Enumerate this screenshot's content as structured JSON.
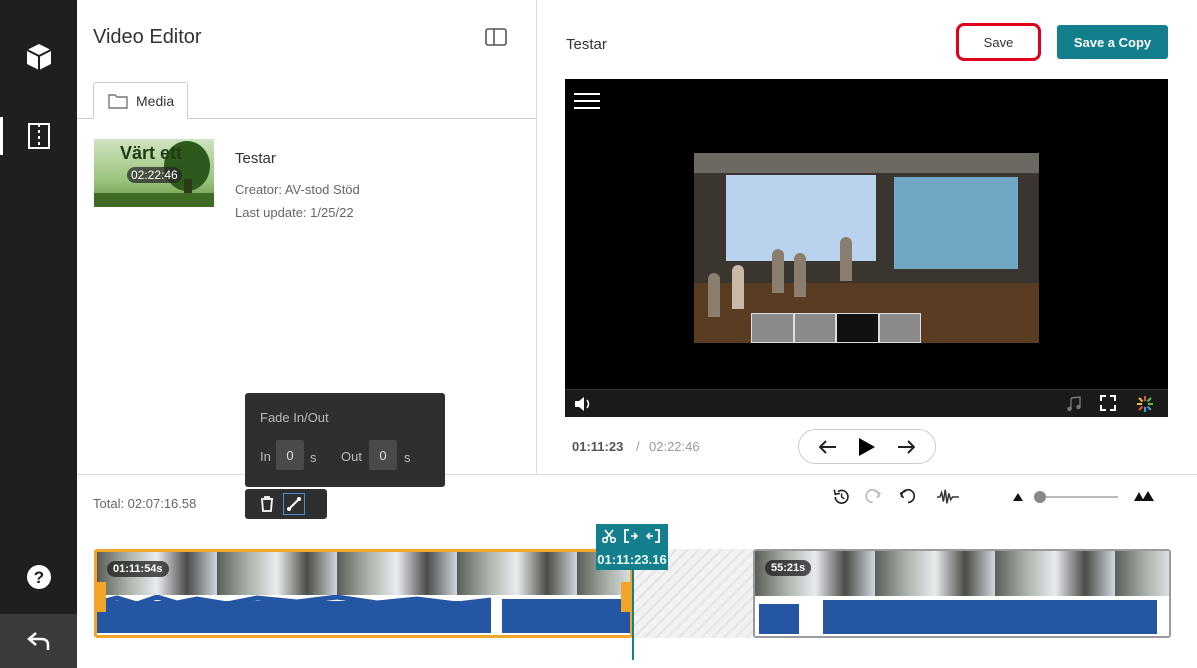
{
  "sidebar": {
    "icons": [
      "cube-icon",
      "film-strip-icon",
      "help-icon",
      "back-icon"
    ]
  },
  "media_panel": {
    "title": "Video Editor",
    "tab_label": "Media",
    "entry": {
      "title": "Testar",
      "creator": "Creator: AV-stod Stöd",
      "last_update": "Last update: 1/25/22",
      "duration": "02:22:46",
      "thumb_text": "Värt ett"
    }
  },
  "preview": {
    "title": "Testar",
    "save_label": "Save",
    "save_copy_label": "Save a Copy",
    "current_time": "01:11:23",
    "separator": "/",
    "total_time": "02:22:46"
  },
  "timeline": {
    "total": "Total: 02:07:16.58",
    "playhead_time": "01:11:23.16",
    "clips": [
      {
        "duration": "01:11:54s"
      },
      {
        "duration": "55:21s"
      }
    ]
  },
  "fade_popup": {
    "title": "Fade In/Out",
    "in_label": "In",
    "in_value": "0",
    "out_label": "Out",
    "out_value": "0",
    "unit": "s"
  },
  "colors": {
    "accent": "#137f8c",
    "clip_selected": "#f3a52a",
    "waveform": "#2456a4",
    "save_highlight": "#e0001b"
  }
}
